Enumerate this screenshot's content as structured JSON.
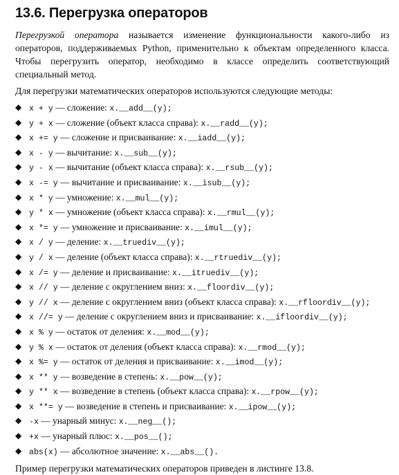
{
  "section": {
    "title": "13.6. Перегрузка операторов",
    "intro": {
      "term": "Перегрузкой оператора",
      "rest": " называется изменение функциональности какого-либо из операторов, поддерживаемых Python, применительно к объектам определенного класса. Чтобы перегрузить оператор, необходимо в классе определить соответствующий специальный метод."
    },
    "lead": "Для перегрузки математических операторов используются следующие методы:",
    "items": [
      {
        "expr": "x + y",
        "desc": " — сложение: ",
        "method": "x.__add__(y);"
      },
      {
        "expr": "y + x",
        "desc": " — сложение (объект класса справа): ",
        "method": "x.__radd__(y);"
      },
      {
        "expr": "x += y",
        "desc": " — сложение и присваивание: ",
        "method": "x.__iadd__(y);"
      },
      {
        "expr": "x - y",
        "desc": " — вычитание: ",
        "method": "x.__sub__(y);"
      },
      {
        "expr": "y - x",
        "desc": " — вычитание (объект класса справа): ",
        "method": "x.__rsub__(y);"
      },
      {
        "expr": "x -= y",
        "desc": " — вычитание и присваивание: ",
        "method": "x.__isub__(y);"
      },
      {
        "expr": "x * y",
        "desc": " — умножение: ",
        "method": "x.__mul__(y);"
      },
      {
        "expr": "y * x",
        "desc": " — умножение (объект класса справа): ",
        "method": "x.__rmul__(y);"
      },
      {
        "expr": "x *= y",
        "desc": " — умножение и присваивание: ",
        "method": "x.__imul__(y);"
      },
      {
        "expr": "x / y",
        "desc": " — деление: ",
        "method": "x.__truediv__(y);"
      },
      {
        "expr": "y / x",
        "desc": " — деление (объект класса справа): ",
        "method": "x.__rtruediv__(y);"
      },
      {
        "expr": "x /= y",
        "desc": " — деление и присваивание: ",
        "method": "x.__itruediv__(y);"
      },
      {
        "expr": "x // y",
        "desc": " — деление с округлением вниз: ",
        "method": "x.__floordiv__(y);"
      },
      {
        "expr": "y // x",
        "desc": " — деление с округлением вниз (объект класса справа): ",
        "method": "x.__rfloordiv__(y);"
      },
      {
        "expr": "x //= y",
        "desc": " — деление с округлением вниз и присваивание: ",
        "method": "x.__ifloordiv__(y);"
      },
      {
        "expr": "x % y",
        "desc": " — остаток от деления: ",
        "method": "x.__mod__(y);"
      },
      {
        "expr": "y % x",
        "desc": " — остаток от деления (объект класса справа): ",
        "method": "x.__rmod__(y);"
      },
      {
        "expr": "x %= y",
        "desc": " — остаток от деления и присваивание: ",
        "method": "x.__imod__(y);"
      },
      {
        "expr": "x ** y",
        "desc": " — возведение в степень: ",
        "method": "x.__pow__(y);"
      },
      {
        "expr": "y ** x",
        "desc": " — возведение в степень (объект класса справа): ",
        "method": "x.__rpow__(y);"
      },
      {
        "expr": "x **= y",
        "desc": " — возведение в степень и присваивание: ",
        "method": "x.__ipow__(y);"
      },
      {
        "expr": "-x",
        "desc": " — унарный минус: ",
        "method": "x.__neg__();"
      },
      {
        "expr": "+x",
        "desc": " — унарный плюс: ",
        "method": "x.__pos__();"
      },
      {
        "expr": "abs(x)",
        "desc": " — абсолютное значение: ",
        "method": "x.__abs__()."
      }
    ],
    "footer": "Пример перегрузки математических операторов приведен в листинге 13.8."
  },
  "icons": {
    "bullet": "diamond-bullet-icon"
  },
  "colors": {
    "text": "#111111",
    "background": "#ffffff"
  }
}
